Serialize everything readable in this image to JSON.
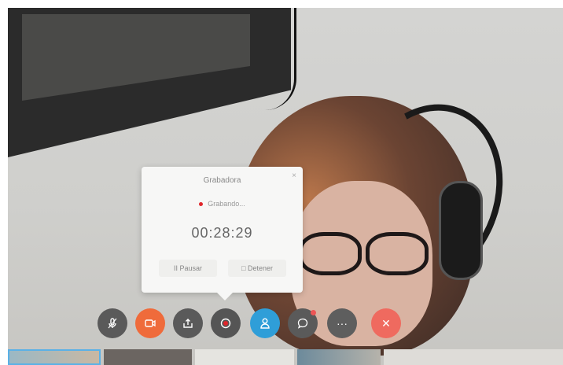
{
  "recording_popup": {
    "title": "Grabadora",
    "close_label": "×",
    "status": "Grabando...",
    "timer": "00:28:29",
    "pause_label": "II Pausar",
    "stop_label": "□ Detener"
  },
  "toolbar": {
    "buttons": [
      {
        "name": "mute",
        "icon": "microphone-icon"
      },
      {
        "name": "video",
        "icon": "video-camera-icon"
      },
      {
        "name": "share",
        "icon": "share-upload-icon"
      },
      {
        "name": "record",
        "icon": "record-icon"
      },
      {
        "name": "participants",
        "icon": "person-icon"
      },
      {
        "name": "chat",
        "icon": "chat-bubble-icon"
      },
      {
        "name": "more",
        "icon": "ellipsis-icon",
        "label": "···"
      },
      {
        "name": "leave",
        "icon": "close-icon",
        "label": "✕"
      }
    ]
  },
  "colors": {
    "record_red": "#e0262b",
    "video_orange": "#ef6b3b",
    "participants_blue": "#2f9ed8",
    "leave_red": "#ef6a5f",
    "button_gray": "#5a5a5a"
  }
}
